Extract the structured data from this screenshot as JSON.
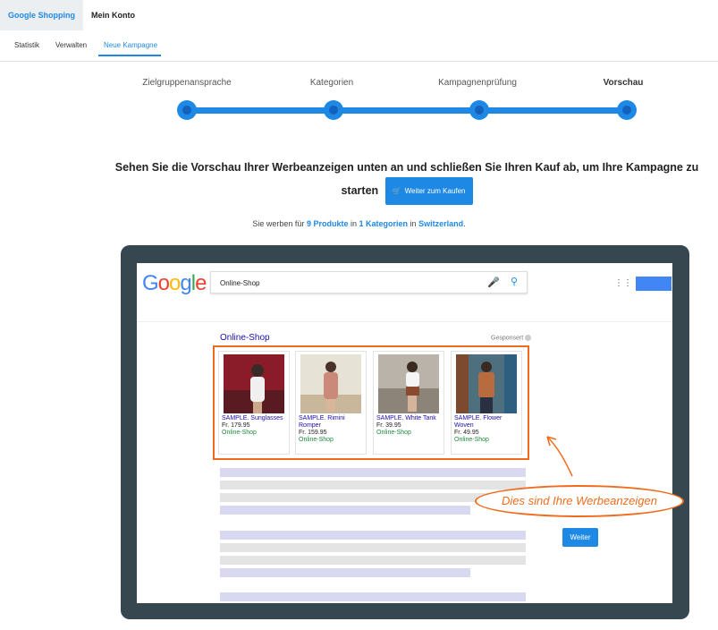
{
  "top_tabs": [
    "Google Shopping",
    "Mein Konto"
  ],
  "sub_tabs": [
    "Statistik",
    "Verwalten",
    "Neue Kampagne"
  ],
  "steps": [
    "Zielgruppenansprache",
    "Kategorien",
    "Kampagnenprüfung",
    "Vorschau"
  ],
  "headline": "Sehen Sie die Vorschau Ihrer Werbeanzeigen unten an und schließen Sie Ihren Kauf ab, um Ihre Kampagne zu starten",
  "cta_label": "Weiter zum Kaufen",
  "info": {
    "prefix": "Sie werben für",
    "products": "9 Produkte",
    "mid": "in",
    "categories": "1 Kategorien",
    "in": "in",
    "country": "Switzerland",
    "suffix": "."
  },
  "google": {
    "logo": "Google",
    "search_value": "Online-Shop",
    "result_title": "Online-Shop",
    "sponsored": "Gesponsert"
  },
  "ads": [
    {
      "title": "SAMPLE. Sunglasses",
      "price": "Fr. 179.95",
      "shop": "Online-Shop"
    },
    {
      "title": "SAMPLE. Rimini Romper",
      "price": "Fr. 159.95",
      "shop": "Online-Shop"
    },
    {
      "title": "SAMPLE. White Tank",
      "price": "Fr. 39.95",
      "shop": "Online-Shop"
    },
    {
      "title": "SAMPLE. Flower Woven",
      "price": "Fr. 49.95",
      "shop": "Online-Shop"
    }
  ],
  "callout": "Dies sind Ihre Werbeanzeigen",
  "weiter": "Weiter",
  "colors": {
    "accent": "#1e88e5",
    "callout": "#ef6c1f",
    "frame": "#37474f"
  }
}
